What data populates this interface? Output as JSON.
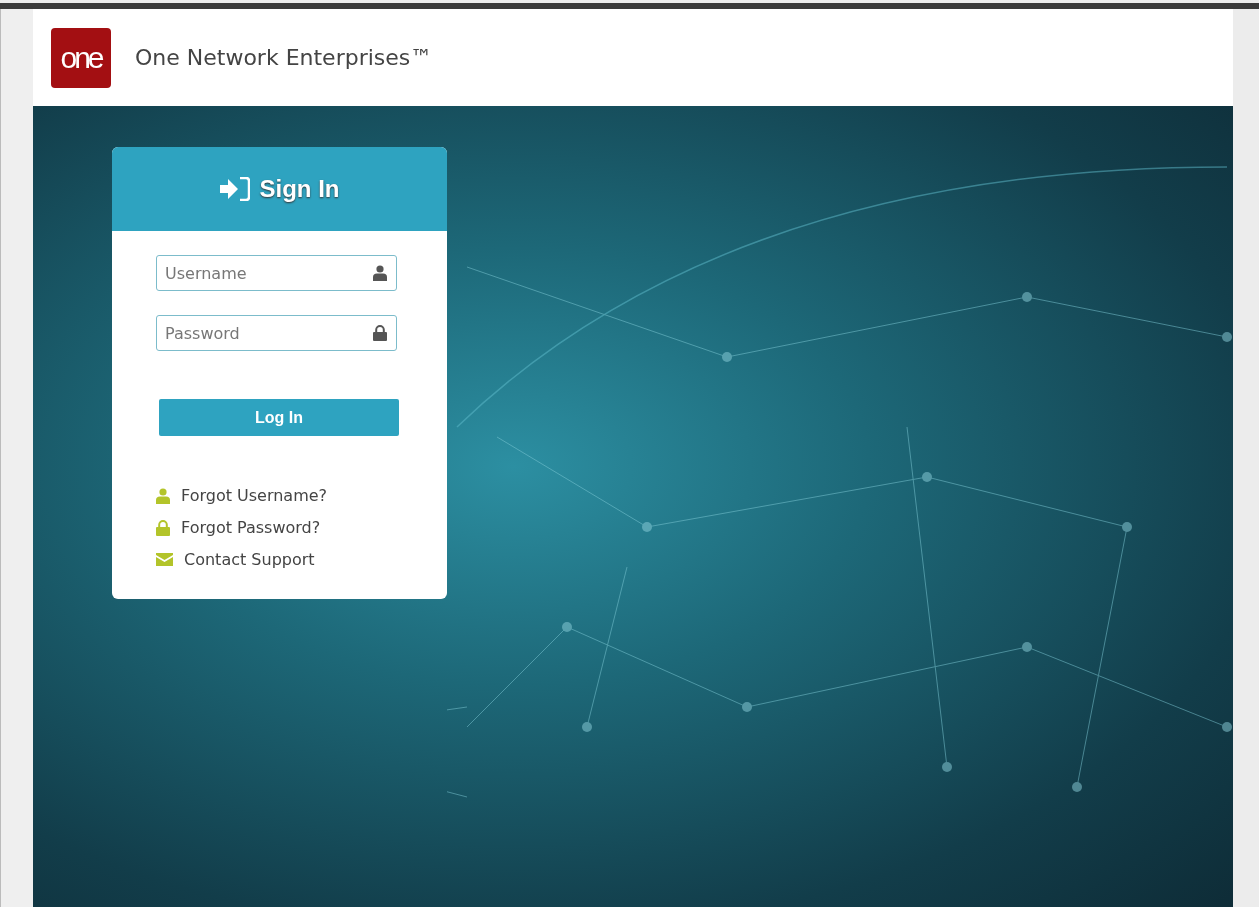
{
  "header": {
    "logo": "one",
    "brand": "One Network Enterprises™"
  },
  "sign_in": {
    "title": "Sign In",
    "fields": [
      {
        "kind": "user",
        "placeholder": "Username"
      },
      {
        "kind": "lock",
        "placeholder": "Password"
      }
    ],
    "login_button": "Log In",
    "links": [
      {
        "kind": "user",
        "label": "Forgot Username?"
      },
      {
        "kind": "lock",
        "label": "Forgot Password?"
      },
      {
        "kind": "mail",
        "label": "Contact Support"
      }
    ]
  }
}
